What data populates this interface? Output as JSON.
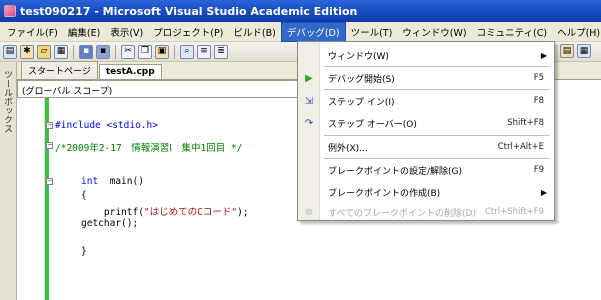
{
  "window": {
    "title": "test090217 - Microsoft Visual Studio Academic Edition"
  },
  "menubar": {
    "items": [
      {
        "label": "ファイル(F)"
      },
      {
        "label": "編集(E)"
      },
      {
        "label": "表示(V)"
      },
      {
        "label": "プロジェクト(P)"
      },
      {
        "label": "ビルド(B)"
      },
      {
        "label": "デバッグ(D)"
      },
      {
        "label": "ツール(T)"
      },
      {
        "label": "ウィンドウ(W)"
      },
      {
        "label": "コミュニティ(C)"
      },
      {
        "label": "ヘルプ(H)"
      }
    ]
  },
  "toolbar": {
    "buttons": [
      {
        "icon": "new-project-icon"
      },
      {
        "icon": "add-item-icon"
      },
      {
        "icon": "open-icon"
      },
      {
        "icon": "add-icon"
      },
      {
        "icon": "save-icon"
      },
      {
        "icon": "save-all-icon"
      },
      {
        "icon": "cut-icon"
      },
      {
        "icon": "copy-icon"
      },
      {
        "icon": "paste-icon"
      },
      {
        "icon": "find-icon"
      },
      {
        "icon": "comment-icon"
      },
      {
        "icon": "uncomment-icon"
      }
    ]
  },
  "toolbox": {
    "label": "ツールボックス"
  },
  "tabs": [
    {
      "label": "スタートページ"
    },
    {
      "label": "testA.cpp"
    }
  ],
  "scope": {
    "value": "(グローバル スコープ)"
  },
  "editor": {
    "lines": [
      {
        "text": "#include <stdio.h>",
        "kind": "directive"
      },
      {
        "text": "/*2009年2-17　情報演習Ⅰ　集中1回目 */",
        "kind": "comment"
      },
      {
        "text": "int  main()",
        "kind": "code"
      },
      {
        "text": "{",
        "kind": "code"
      },
      {
        "text": "    printf(\"はじめてのCコード\");",
        "kind": "code"
      },
      {
        "text": "getchar();",
        "kind": "code"
      },
      {
        "text": "}",
        "kind": "code"
      }
    ]
  },
  "debug_menu": {
    "items": [
      {
        "label": "ウィンドウ(W)",
        "shortcut": "",
        "submenu": true,
        "icon": "",
        "disabled": false
      },
      {
        "label": "デバッグ開始(S)",
        "shortcut": "F5",
        "submenu": false,
        "icon": "start-debug-icon",
        "disabled": false
      },
      {
        "label": "ステップ イン(I)",
        "shortcut": "F8",
        "submenu": false,
        "icon": "step-into-icon",
        "disabled": false
      },
      {
        "label": "ステップ オーバー(O)",
        "shortcut": "Shift+F8",
        "submenu": false,
        "icon": "step-over-icon",
        "disabled": false
      },
      {
        "label": "例外(X)...",
        "shortcut": "Ctrl+Alt+E",
        "submenu": false,
        "icon": "",
        "disabled": false
      },
      {
        "label": "ブレークポイントの設定/解除(G)",
        "shortcut": "F9",
        "submenu": false,
        "icon": "",
        "disabled": false
      },
      {
        "label": "ブレークポイントの作成(B)",
        "shortcut": "",
        "submenu": true,
        "icon": "",
        "disabled": false
      },
      {
        "label": "すべてのブレークポイントの削除(D)",
        "shortcut": "Ctrl+Shift+F9",
        "submenu": false,
        "icon": "delete-breakpoints-icon",
        "disabled": true
      }
    ]
  },
  "colors": {
    "titlebar": "#1a4fc6",
    "menu_highlight": "#3168c9",
    "change_bar": "#3fbf3f",
    "keyword": "#0000ff",
    "comment": "#008000",
    "string": "#a31515"
  }
}
